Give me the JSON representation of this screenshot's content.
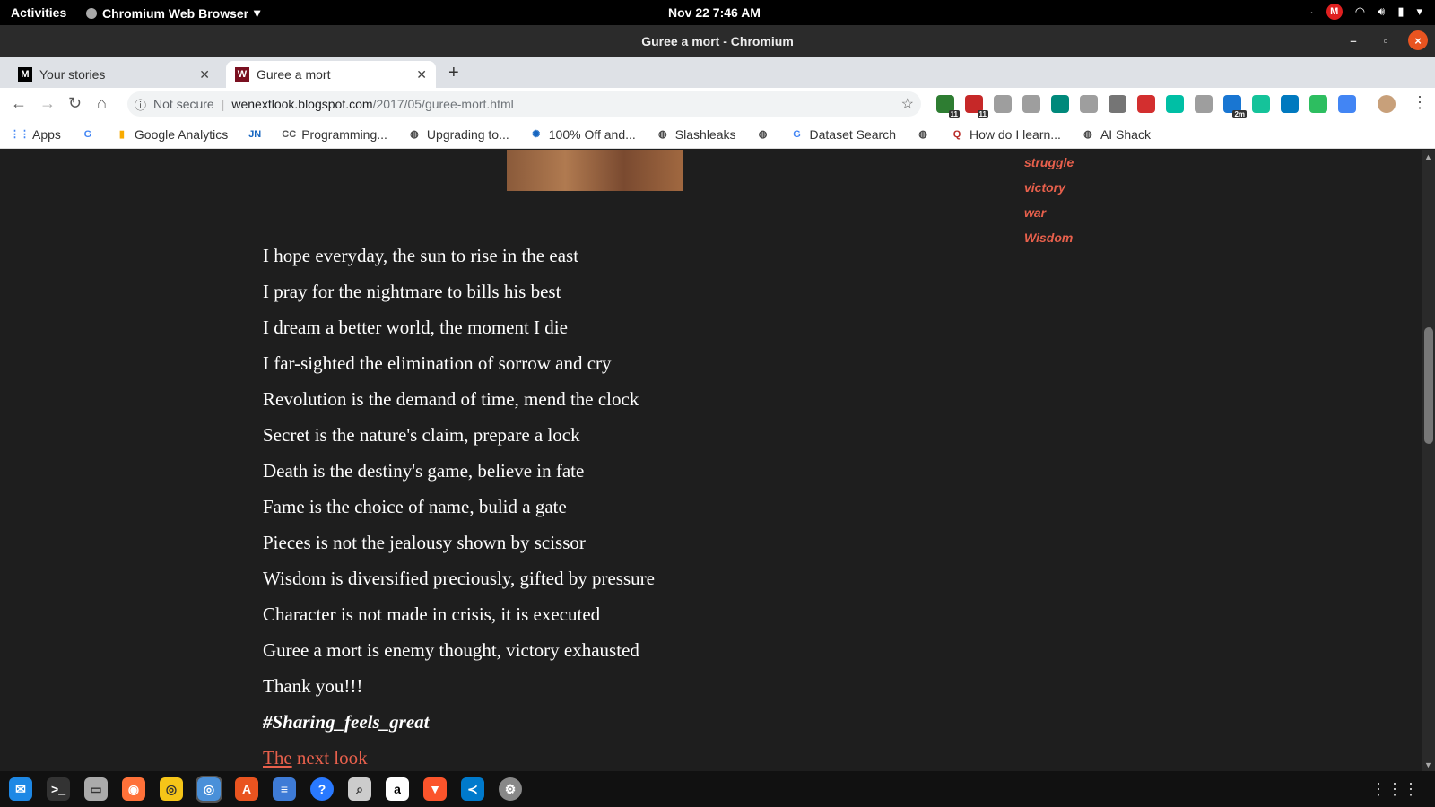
{
  "system": {
    "activities": "Activities",
    "app_name": "Chromium Web Browser",
    "clock": "Nov 22  7:46 AM",
    "mail_badge": "M"
  },
  "window": {
    "title": "Guree a mort - Chromium"
  },
  "tabs": [
    {
      "label": "Your stories",
      "favicon": "M"
    },
    {
      "label": "Guree a mort",
      "favicon": "W"
    }
  ],
  "omnibox": {
    "security": "Not secure",
    "host": "wenextlook.blogspot.com",
    "path": "/2017/05/guree-mort.html"
  },
  "extensions": [
    {
      "name": "ext-green-badge",
      "color": "#2e7d32",
      "badge": "11"
    },
    {
      "name": "ext-red-badge",
      "color": "#c62828",
      "badge": "11"
    },
    {
      "name": "dropbox",
      "color": "#9e9e9e",
      "badge": ""
    },
    {
      "name": "camera",
      "color": "#9e9e9e",
      "badge": ""
    },
    {
      "name": "ext-teal",
      "color": "#00897b",
      "badge": ""
    },
    {
      "name": "ext-grid",
      "color": "#9e9e9e",
      "badge": ""
    },
    {
      "name": "ext-grey",
      "color": "#757575",
      "badge": ""
    },
    {
      "name": "ext-red-dots",
      "color": "#d32f2f",
      "badge": ""
    },
    {
      "name": "ext-m",
      "color": "#00bfa5",
      "badge": ""
    },
    {
      "name": "pocket",
      "color": "#9e9e9e",
      "badge": ""
    },
    {
      "name": "ext-blue-2m",
      "color": "#1976d2",
      "badge": "2m"
    },
    {
      "name": "grammarly",
      "color": "#15c39a",
      "badge": ""
    },
    {
      "name": "trello",
      "color": "#0079bf",
      "badge": ""
    },
    {
      "name": "evernote",
      "color": "#2dbe60",
      "badge": ""
    },
    {
      "name": "translate",
      "color": "#4285f4",
      "badge": ""
    }
  ],
  "bookmarks": [
    {
      "label": "Apps",
      "icon": "apps"
    },
    {
      "label": "",
      "icon": "G"
    },
    {
      "label": "Google Analytics",
      "icon": "analytics"
    },
    {
      "label": "",
      "icon": "JN"
    },
    {
      "label": "Programming...",
      "icon": "CC"
    },
    {
      "label": "Upgrading to...",
      "icon": "globe"
    },
    {
      "label": "100% Off and...",
      "icon": "spiral"
    },
    {
      "label": "Slashleaks",
      "icon": "globe"
    },
    {
      "label": "",
      "icon": "globe"
    },
    {
      "label": "Dataset Search",
      "icon": "G"
    },
    {
      "label": "",
      "icon": "globe"
    },
    {
      "label": "How do I learn...",
      "icon": "Q"
    },
    {
      "label": "AI Shack",
      "icon": "globe"
    }
  ],
  "sidebar_labels": [
    "struggle",
    "victory",
    "war",
    "Wisdom"
  ],
  "poem": {
    "lines": [
      "I hope everyday, the sun to rise in the east",
      "I pray for the nightmare to bills his best",
      "I dream a better world, the moment I die",
      "I far-sighted the elimination of sorrow and cry",
      "Revolution is the demand of time, mend the clock",
      "Secret is the nature's claim, prepare a lock",
      "Death is the destiny's game, believe in fate",
      "Fame is the choice of name, bulid a gate",
      "Pieces is not the jealousy shown by scissor",
      "Wisdom is diversified preciously, gifted by pressure",
      "Character is not made in crisis, it is executed",
      "Guree a mort is enemy thought, victory exhausted",
      "Thank you!!!"
    ],
    "hashtag": "#Sharing_feels_great",
    "link_text": "The",
    "link_rest": " next look"
  }
}
